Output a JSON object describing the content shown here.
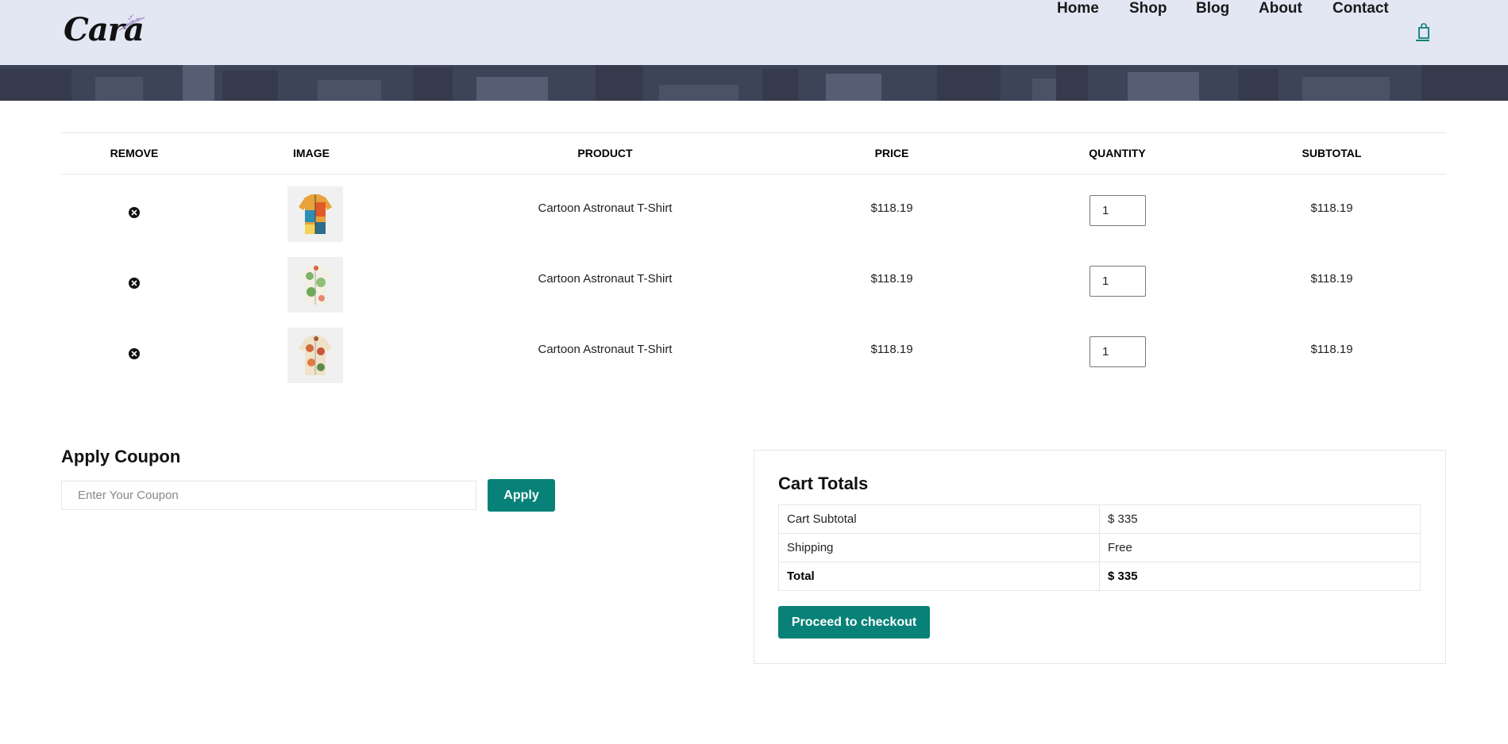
{
  "header": {
    "logo_text": "Cara",
    "nav": [
      "Home",
      "Shop",
      "Blog",
      "About",
      "Contact"
    ],
    "cart_icon": "shopping-bag-icon",
    "accent_color": "#088178",
    "background_color": "#e3e6f3"
  },
  "cart": {
    "headers": {
      "remove": "REMOVE",
      "image": "IMAGE",
      "product": "PRODUCT",
      "price": "PRICE",
      "quantity": "QUANTITY",
      "subtotal": "SUBTOTAL"
    },
    "rows": [
      {
        "product": "Cartoon Astronaut T-Shirt",
        "price": "$118.19",
        "quantity": "1",
        "subtotal": "$118.19",
        "image": "colorful-shirt"
      },
      {
        "product": "Cartoon Astronaut T-Shirt",
        "price": "$118.19",
        "quantity": "1",
        "subtotal": "$118.19",
        "image": "floral-shirt-green"
      },
      {
        "product": "Cartoon Astronaut T-Shirt",
        "price": "$118.19",
        "quantity": "1",
        "subtotal": "$118.19",
        "image": "floral-shirt-red"
      }
    ]
  },
  "coupon": {
    "title": "Apply Coupon",
    "placeholder": "Enter Your Coupon",
    "button": "Apply"
  },
  "totals": {
    "title": "Cart Totals",
    "rows": [
      {
        "label": "Cart Subtotal",
        "value": "$ 335"
      },
      {
        "label": "Shipping",
        "value": "Free"
      },
      {
        "label": "Total",
        "value": "$ 335"
      }
    ],
    "button": "Proceed to checkout"
  }
}
